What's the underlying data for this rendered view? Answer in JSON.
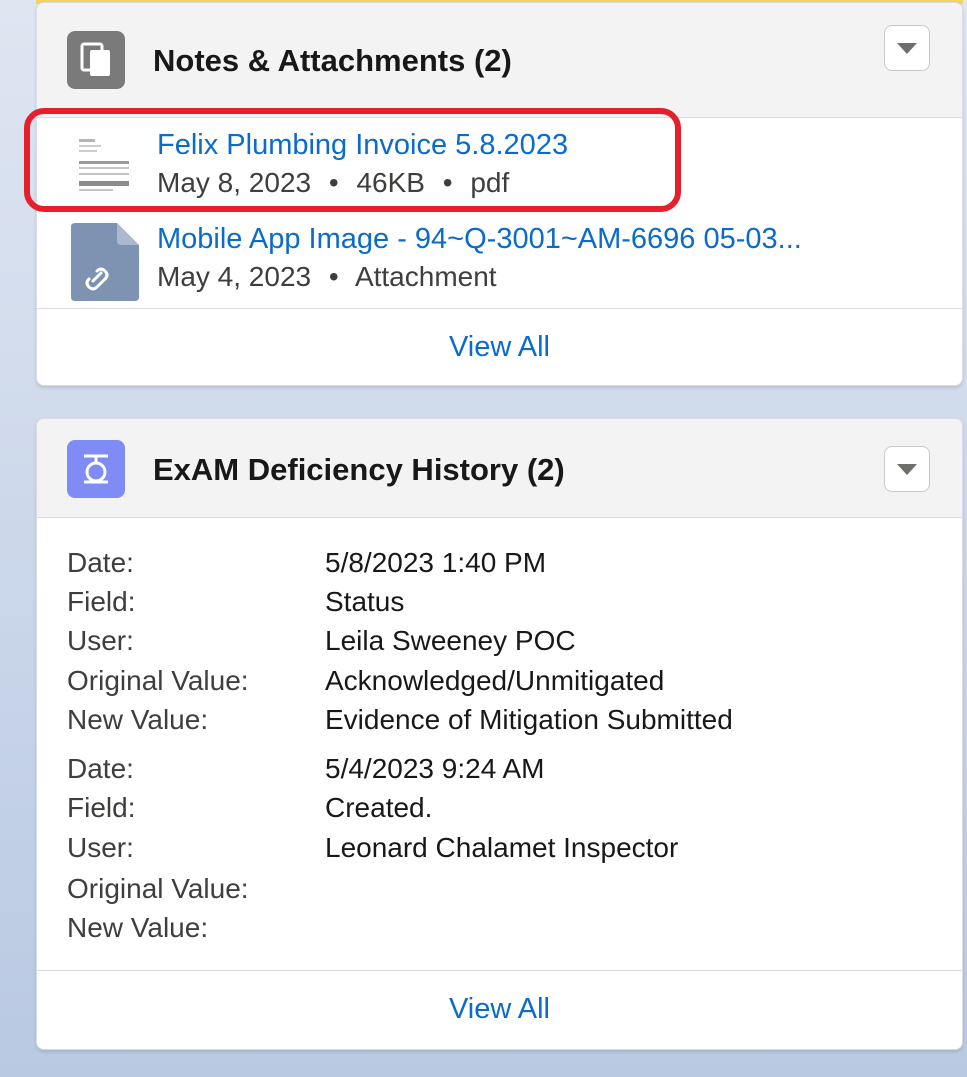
{
  "notes_card": {
    "title": "Notes & Attachments (2)",
    "items": [
      {
        "title": "Felix Plumbing Invoice 5.8.2023",
        "date": "May 8, 2023",
        "size": "46KB",
        "type": "pdf",
        "icon": "pdf-thumbnail-icon"
      },
      {
        "title": "Mobile App Image - 94~Q-3001~AM-6696 05-03...",
        "date": "May 4, 2023",
        "type": "Attachment",
        "icon": "attachment-file-icon"
      }
    ],
    "separator": "•",
    "view_all": "View All",
    "icon": "notes-icon"
  },
  "history_card": {
    "title": "ExAM Deficiency History (2)",
    "icon": "deficiency-history-icon",
    "labels": {
      "date": "Date:",
      "field": "Field:",
      "user": "User:",
      "original": "Original Value:",
      "new": "New Value:"
    },
    "entries": [
      {
        "date": "5/8/2023 1:40 PM",
        "field": "Status",
        "user": "Leila Sweeney POC",
        "original": "Acknowledged/Unmitigated",
        "new": "Evidence of Mitigation Submitted"
      },
      {
        "date": "5/4/2023 9:24 AM",
        "field": "Created.",
        "user": "Leonard Chalamet Inspector",
        "original": "",
        "new": ""
      }
    ],
    "view_all": "View All"
  },
  "colors": {
    "link": "#0b6bcb",
    "highlight": "#e5202c",
    "notes_icon_bg": "#7a7a7a",
    "history_icon_bg": "#7f8cf5"
  }
}
